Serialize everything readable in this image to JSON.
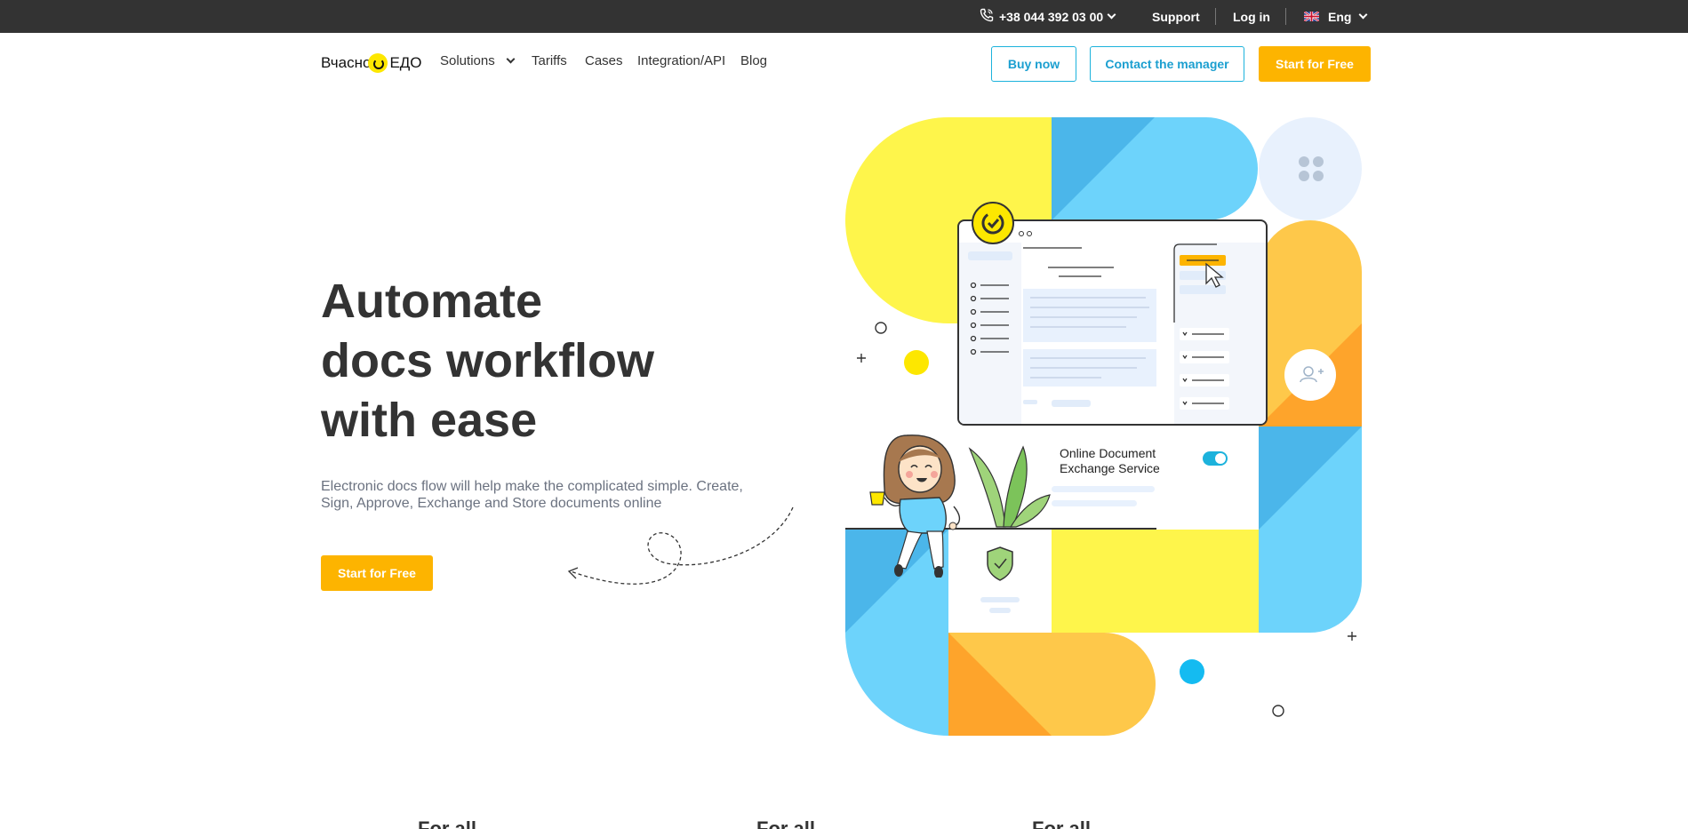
{
  "topbar": {
    "phone": "+38 044 392 03 00",
    "support": "Support",
    "login": "Log in",
    "language": "Eng"
  },
  "header": {
    "logo_left": "Вчасно",
    "logo_right": "ЕДО",
    "nav": {
      "solutions": "Solutions",
      "tariffs": "Tariffs",
      "cases": "Cases",
      "integration": "Integration/API",
      "blog": "Blog"
    },
    "buy_now": "Buy now",
    "contact_manager": "Contact the manager",
    "start_free": "Start for Free"
  },
  "hero": {
    "title_line1": "Automate",
    "title_line2": "docs workflow",
    "title_line3": "with ease",
    "subtitle": "Electronic docs flow will help make the complicated simple. Create, Sign, Approve, Exchange and Store documents online",
    "cta": "Start for Free"
  },
  "illustration": {
    "service_label_line1": "Online Document",
    "service_label_line2": "Exchange Service"
  },
  "teaser": {
    "item1": "For all",
    "item2": "For all",
    "item3": "For all"
  },
  "colors": {
    "accent_yellow": "#fdb400",
    "accent_blue": "#1cb2dc",
    "topbar_bg": "#333333",
    "shape_yellow": "#fef54b",
    "shape_lightblue": "#6dd3fb",
    "shape_blue": "#4bb6ea",
    "shape_orange": "#fec84a",
    "shape_darkorange": "#fea42b"
  }
}
